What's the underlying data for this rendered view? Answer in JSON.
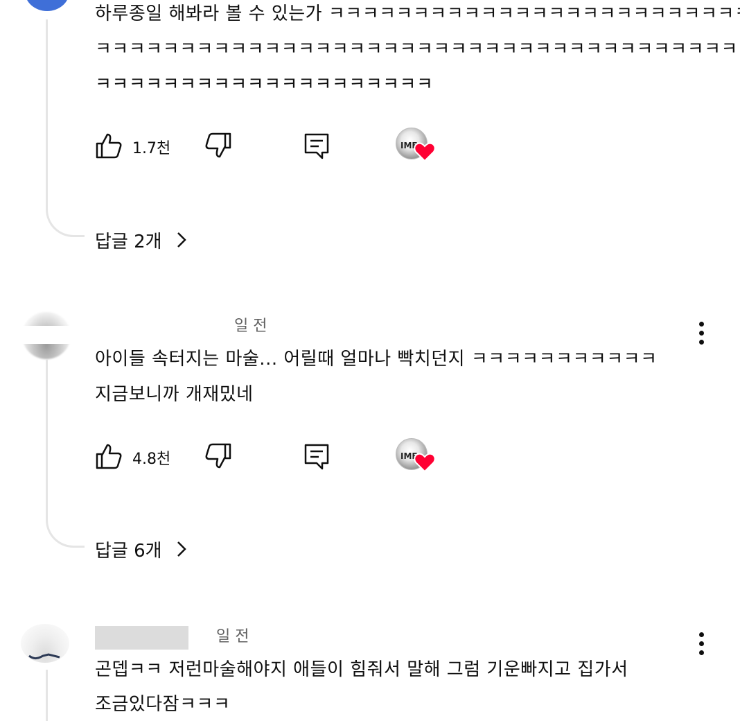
{
  "comments": [
    {
      "text_lines": [
        "하루종일 해봐라 볼 수 있는가 ㅋㅋㅋㅋㅋㅋㅋㅋㅋㅋㅋㅋㅋㅋㅋㅋㅋㅋㅋㅋㅋㅋㅋㅋㅋㅋㅋㅋㅋ",
        "ㅋㅋㅋㅋㅋㅋㅋㅋㅋㅋㅋㅋㅋㅋㅋㅋㅋㅋㅋㅋㅋㅋㅋㅋㅋㅋㅋㅋㅋㅋㅋㅋㅋㅋㅋㅋㅋㅋㅋㅋㅋㅋㅋㅋㅋㅋㅋ",
        "ㅋㅋㅋㅋㅋㅋㅋㅋㅋㅋㅋㅋㅋㅋㅋㅋㅋㅋㅋㅋ"
      ],
      "like_count": "1.7천",
      "replies_label": "답글 2개"
    },
    {
      "time": "일 전",
      "text_lines": [
        "아이들 속터지는 마술... 어릴때 얼마나 빡치던지 ㅋㅋㅋㅋㅋㅋㅋㅋㅋㅋㅋ",
        "지금보니까 개재밌네"
      ],
      "like_count": "4.8천",
      "replies_label": "답글 6개"
    },
    {
      "time": "일 전",
      "text_lines": [
        "곤뎁ㅋㅋ 저런마술해야지 애들이 힘줘서 말해 그럼 기운빠지고 집가서",
        "조금있다잠ㅋㅋㅋ"
      ]
    }
  ],
  "creator_avatar_text": "IMF",
  "colors": {
    "heart": "#ff0033",
    "thread_line": "#e5e5e5",
    "meta_text": "#606060"
  }
}
